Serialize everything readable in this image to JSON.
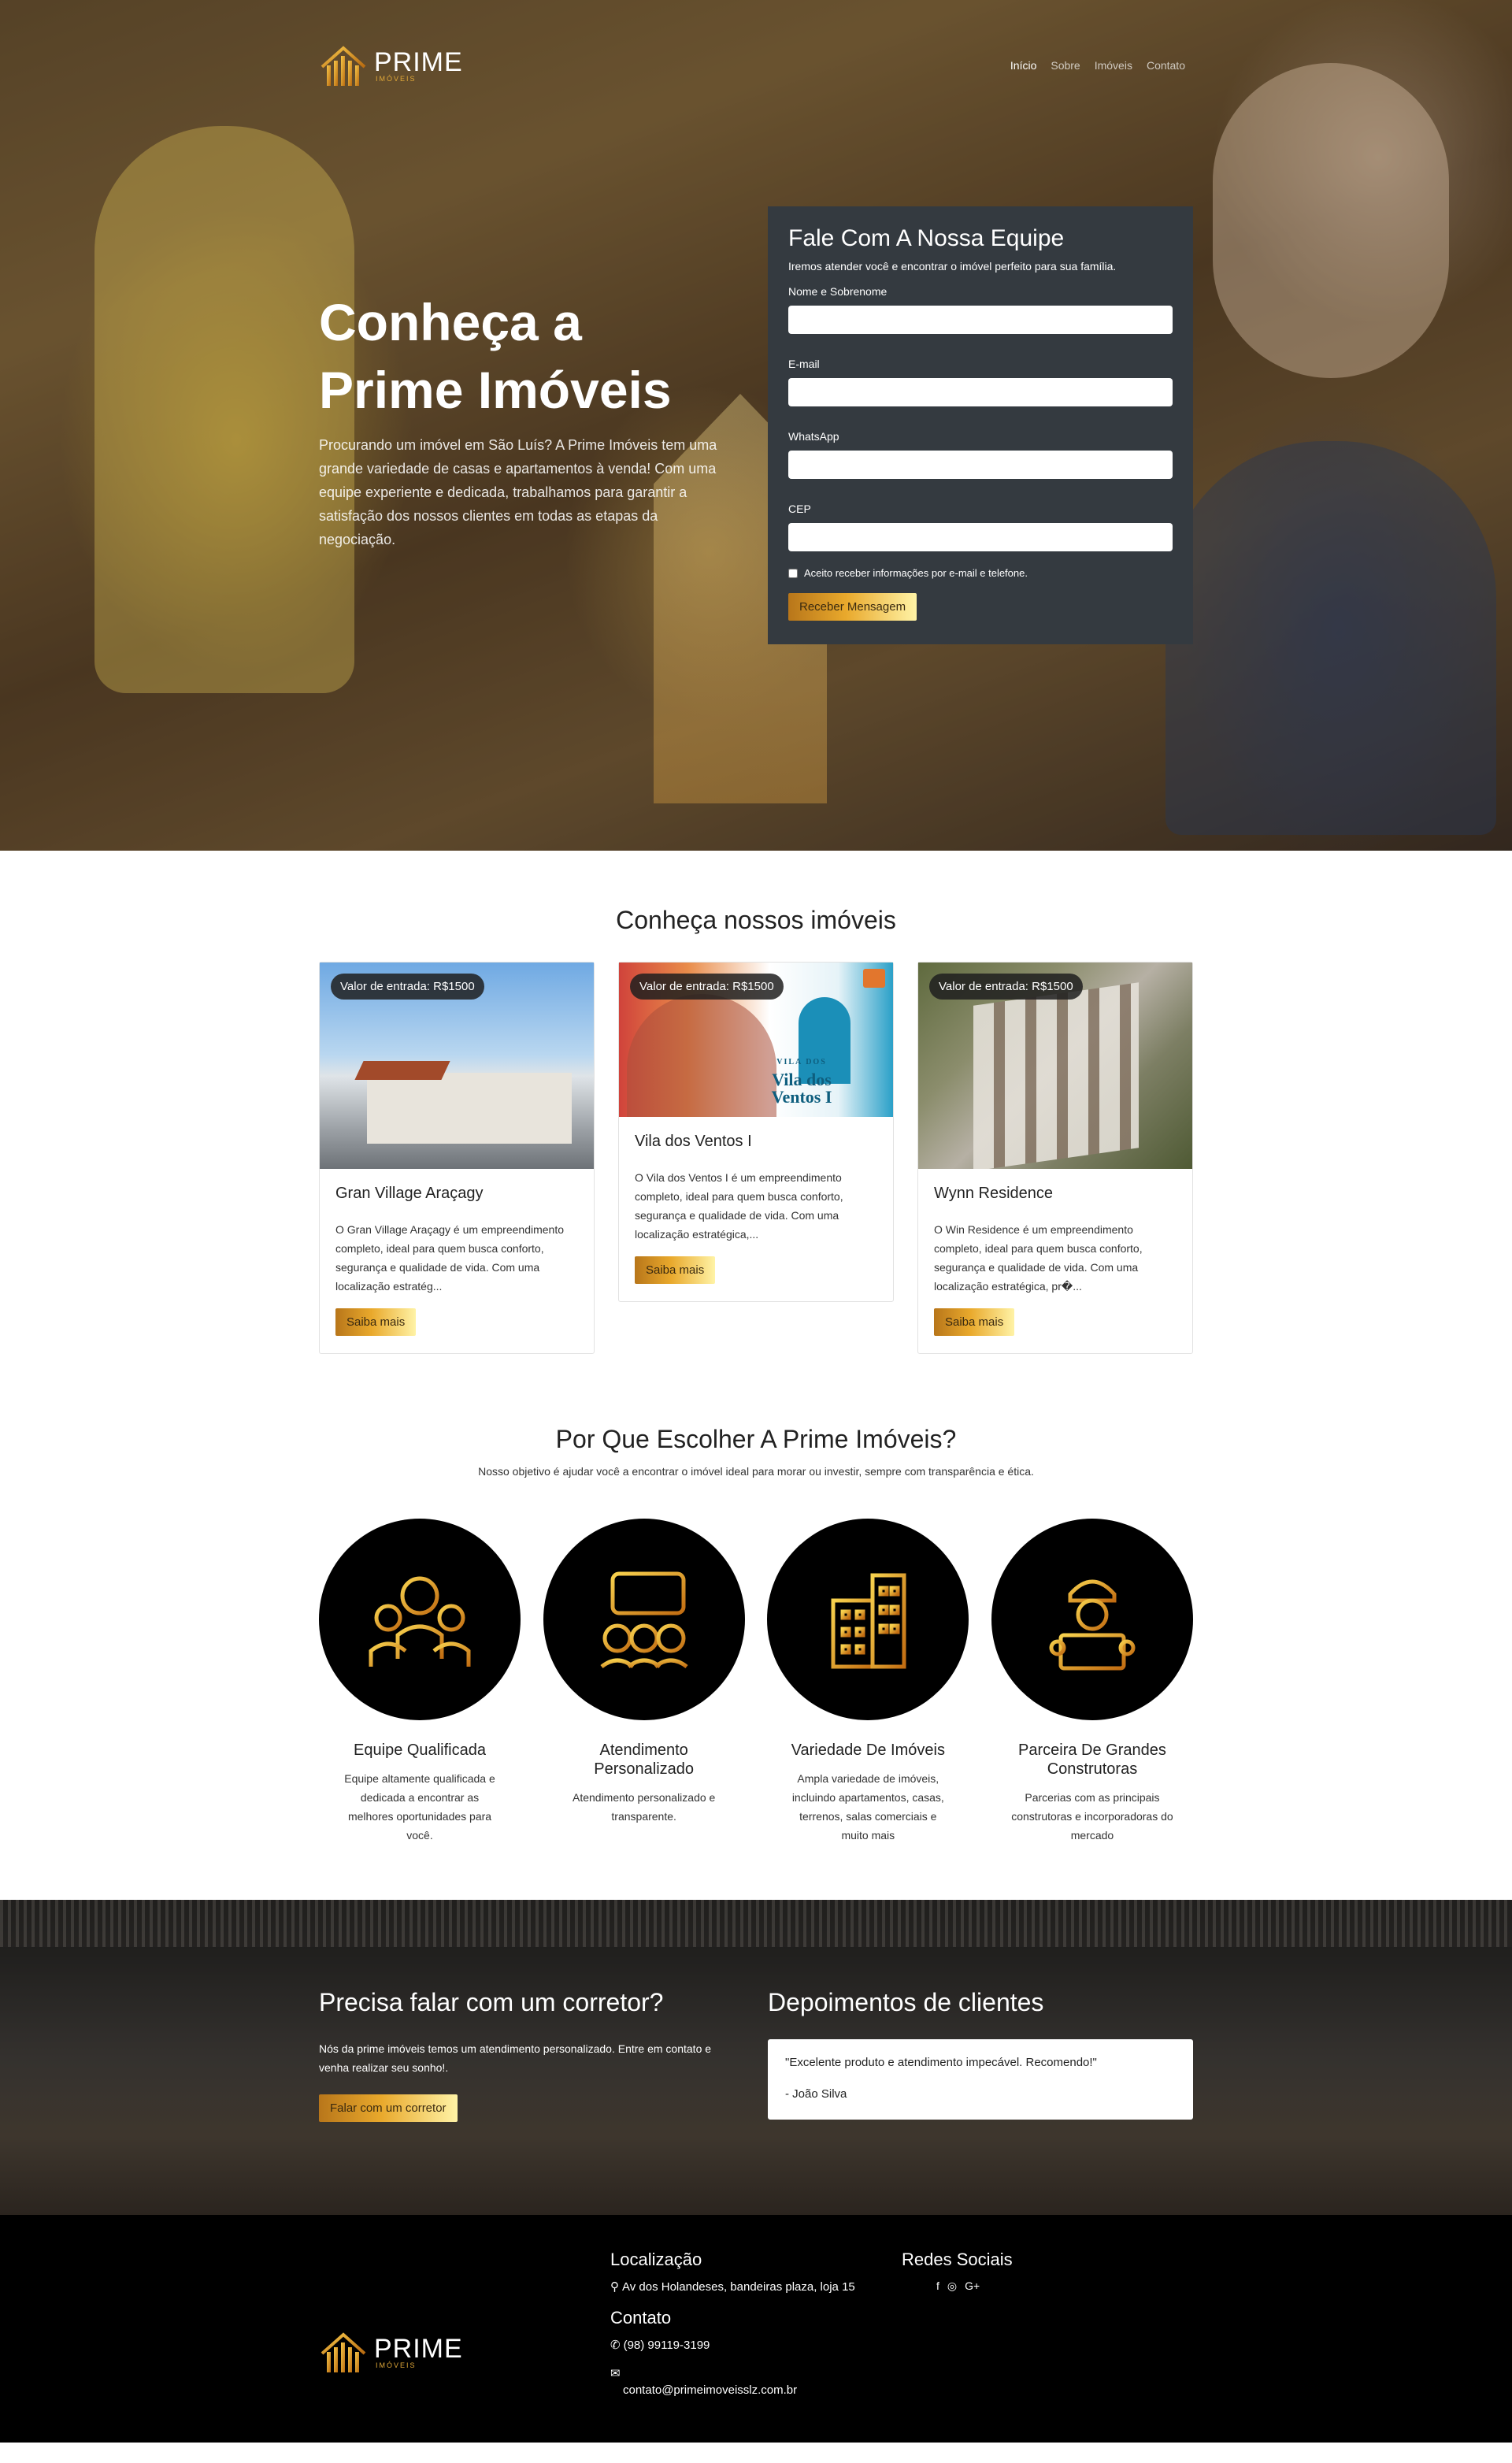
{
  "nav": {
    "logo_text": "PRIME",
    "logo_sub": "IMÓVEIS",
    "links": [
      "Início",
      "Sobre",
      "Imóveis",
      "Contato"
    ]
  },
  "hero": {
    "title_line1": "Conheça a",
    "title_line2": "Prime Imóveis",
    "description": "Procurando um imóvel em São Luís? A Prime Imóveis tem uma grande variedade de casas e apartamentos à venda! Com uma equipe experiente e dedicada, trabalhamos para garantir a satisfação dos nossos clientes em todas as etapas da negociação."
  },
  "form": {
    "title": "Fale Com A Nossa Equipe",
    "subtitle": "Iremos atender você e encontrar o imóvel perfeito para sua família.",
    "fields": [
      {
        "label": "Nome e Sobrenome",
        "value": ""
      },
      {
        "label": "E-mail",
        "value": ""
      },
      {
        "label": "WhatsApp",
        "value": ""
      },
      {
        "label": "CEP",
        "value": ""
      }
    ],
    "consent": "Aceito receber informações por e-mail e telefone.",
    "submit": "Receber Mensagem"
  },
  "properties": {
    "title": "Conheça nossos imóveis",
    "items": [
      {
        "badge": "Valor de entrada: R$1500",
        "name": "Gran Village Araçagy",
        "description": "O Gran Village Araçagy é um empreendimento completo, ideal para quem busca conforto, segurança e qualidade de vida. Com uma localização estratég...",
        "button": "Saiba mais"
      },
      {
        "badge": "Valor de entrada: R$1500",
        "image_text_top": "VILA DOS",
        "image_text": "Vila dos Ventos I",
        "name": "Vila dos Ventos I",
        "description": "O Vila dos Ventos I é um empreendimento completo, ideal para quem busca conforto, segurança e qualidade de vida. Com uma localização estratégica,...",
        "button": "Saiba mais"
      },
      {
        "badge": "Valor de entrada: R$1500",
        "name": "Wynn Residence",
        "description": "O Win Residence é um empreendimento completo, ideal para quem busca conforto, segurança e qualidade de vida. Com uma localização estratégica, pr�...",
        "button": "Saiba mais"
      }
    ]
  },
  "why": {
    "title": "Por Que Escolher A Prime Imóveis?",
    "lead": "Nosso objetivo é ajudar você a encontrar o imóvel ideal para morar ou investir, sempre com transparência e ética.",
    "features": [
      {
        "icon": "team-icon",
        "title": "Equipe Qualificada",
        "text": "Equipe altamente qualificada e dedicada a encontrar as melhores oportunidades para você."
      },
      {
        "icon": "chat-people-icon",
        "title": "Atendimento Personalizado",
        "text": "Atendimento personalizado e transparente."
      },
      {
        "icon": "buildings-icon",
        "title": "Variedade De Imóveis",
        "text": "Ampla variedade de imóveis, incluindo apartamentos, casas, terrenos, salas comerciais e muito mais"
      },
      {
        "icon": "engineer-icon",
        "title": "Parceira De Grandes Construtoras",
        "text": "Parcerias com as principais construtoras e incorporadoras do mercado"
      }
    ]
  },
  "contact_strip": {
    "title": "Precisa falar com um corretor?",
    "text": "Nós da prime imóveis temos um atendimento personalizado. Entre em contato e venha realizar seu sonho!.",
    "button": "Falar com um corretor",
    "testimonials_title": "Depoimentos de clientes",
    "quote": "\"Excelente produto e atendimento impecável. Recomendo!\"",
    "author": "- João Silva"
  },
  "footer": {
    "location_title": "Localização",
    "address": "Av dos Holandeses, bandeiras plaza, loja 15",
    "contact_title": "Contato",
    "phone": "(98) 99119-3199",
    "email": "contato@primeimoveisslz.com.br",
    "social_title": "Redes Sociais",
    "social": [
      "f",
      "◎",
      "G+"
    ]
  },
  "colors": {
    "gold_dark": "#b8761a",
    "gold": "#e9a92c",
    "gold_light": "#fff3a6",
    "form_bg": "#343a40",
    "footer_bg": "#000000"
  }
}
